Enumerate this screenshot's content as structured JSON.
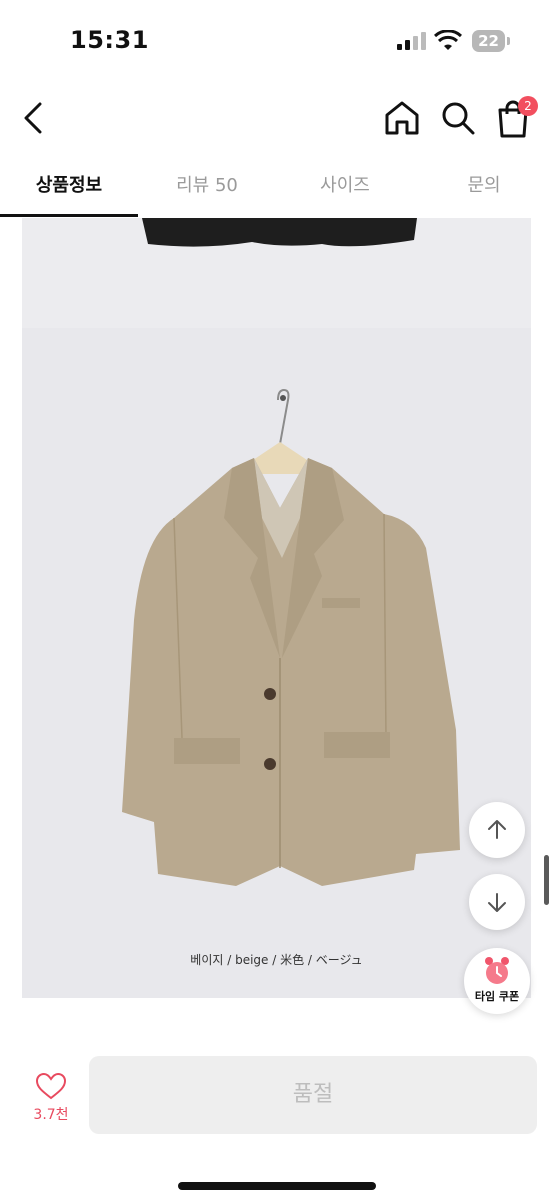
{
  "status_bar": {
    "time": "15:31",
    "battery": "22",
    "icons": [
      "signal-icon",
      "wifi-icon",
      "battery-icon"
    ]
  },
  "nav": {
    "icons": [
      "back-icon",
      "home-icon",
      "search-icon",
      "cart-icon"
    ],
    "cart_count": "2"
  },
  "tabs": [
    {
      "label": "상품정보",
      "active": true
    },
    {
      "label": "리뷰 50",
      "active": false
    },
    {
      "label": "사이즈",
      "active": false
    },
    {
      "label": "문의",
      "active": false
    }
  ],
  "product": {
    "caption": "베이지 / beige / 米色 / ベージュ",
    "colors": {
      "jacket": "#b9a98f",
      "background": "#e8e8ec"
    }
  },
  "floating": {
    "icons": [
      "arrow-up-icon",
      "arrow-down-icon",
      "alarm-clock-icon"
    ],
    "coupon_label": "타임 쿠폰"
  },
  "bottom_bar": {
    "like_count": "3.7천",
    "soldout_label": "품절",
    "accent": "#e84a5f"
  }
}
